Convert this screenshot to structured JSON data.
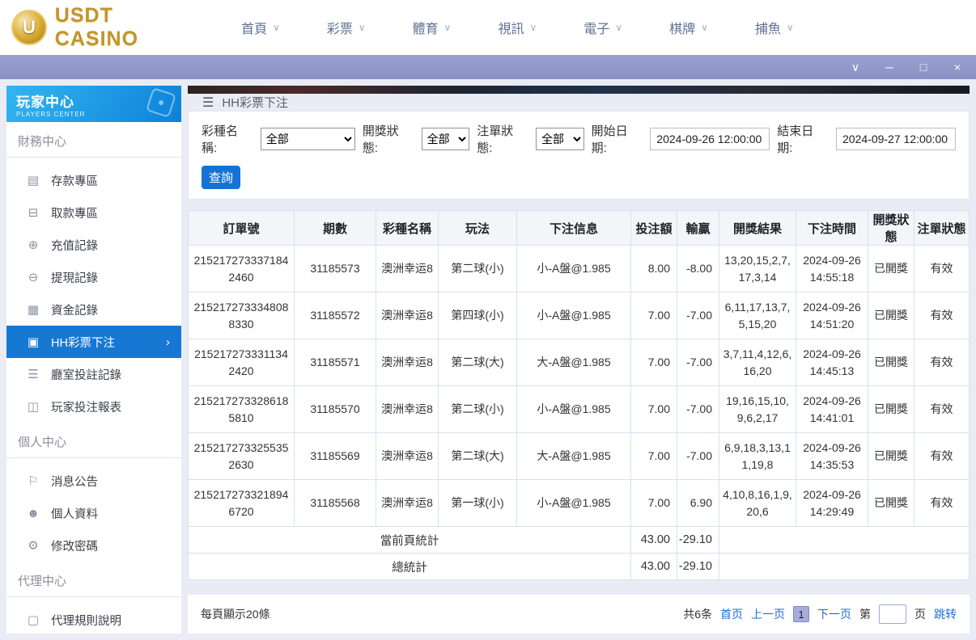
{
  "icons": {
    "hamburger": "☰",
    "nav_chevron": "∨",
    "active_chevron": "›",
    "win_chevron": "∨",
    "win_minimize": "─",
    "win_maximize": "□",
    "win_close": "×"
  },
  "topnav": {
    "logo_initial": "U",
    "logo_text": "USDT CASINO",
    "items": [
      {
        "label": "首頁"
      },
      {
        "label": "彩票"
      },
      {
        "label": "體育"
      },
      {
        "label": "視訊"
      },
      {
        "label": "電子"
      },
      {
        "label": "棋牌"
      },
      {
        "label": "捕魚"
      }
    ]
  },
  "sidebar": {
    "title": "玩家中心",
    "subtitle": "PLAYERS CENTER",
    "sections": [
      {
        "label": "財務中心",
        "items": [
          {
            "glyph": "▤",
            "label": "存款專區"
          },
          {
            "glyph": "⊟",
            "label": "取款專區"
          },
          {
            "glyph": "⊕",
            "label": "充值記錄"
          },
          {
            "glyph": "⊖",
            "label": "提現記錄"
          },
          {
            "glyph": "▦",
            "label": "資金記錄"
          },
          {
            "glyph": "▣",
            "label": "HH彩票下注"
          },
          {
            "glyph": "☰",
            "label": "廳室投註記錄"
          },
          {
            "glyph": "◫",
            "label": "玩家投注報表"
          }
        ]
      },
      {
        "label": "個人中心",
        "items": [
          {
            "glyph": "⚐",
            "label": "消息公告"
          },
          {
            "glyph": "☻",
            "label": "個人資料"
          },
          {
            "glyph": "⚙",
            "label": "修改密碼"
          }
        ]
      },
      {
        "label": "代理中心",
        "items": [
          {
            "glyph": "▢",
            "label": "代理規則說明"
          }
        ]
      }
    ]
  },
  "main": {
    "breadcrumb": "HH彩票下注",
    "filters": {
      "lottery_label": "彩種名稱:",
      "lottery_value": "全部",
      "draw_status_label": "開獎狀態:",
      "draw_status_value": "全部",
      "order_status_label": "注單狀態:",
      "order_status_value": "全部",
      "start_label": "開始日期:",
      "start_value": "2024-09-26 12:00:00",
      "end_label": "結束日期:",
      "end_value": "2024-09-27 12:00:00",
      "search_button": "查詢"
    },
    "table": {
      "headers": [
        "訂單號",
        "期數",
        "彩種名稱",
        "玩法",
        "下注信息",
        "投注額",
        "輸贏",
        "開獎結果",
        "下注時間",
        "開獎狀態",
        "注單狀態"
      ],
      "rows": [
        {
          "order_no": "2152172733371842460",
          "period": "31185573",
          "lottery": "澳洲幸运8",
          "play": "第二球(小)",
          "bet_info": "小-A盤@1.985",
          "amount": "8.00",
          "win": "-8.00",
          "result": "13,20,15,2,7,17,3,14",
          "time": "2024-09-26 14:55:18",
          "draw_status": "已開獎",
          "order_status": "有效"
        },
        {
          "order_no": "2152172733348088330",
          "period": "31185572",
          "lottery": "澳洲幸运8",
          "play": "第四球(小)",
          "bet_info": "小-A盤@1.985",
          "amount": "7.00",
          "win": "-7.00",
          "result": "6,11,17,13,7,5,15,20",
          "time": "2024-09-26 14:51:20",
          "draw_status": "已開獎",
          "order_status": "有效"
        },
        {
          "order_no": "2152172733311342420",
          "period": "31185571",
          "lottery": "澳洲幸运8",
          "play": "第二球(大)",
          "bet_info": "大-A盤@1.985",
          "amount": "7.00",
          "win": "-7.00",
          "result": "3,7,11,4,12,6,16,20",
          "time": "2024-09-26 14:45:13",
          "draw_status": "已開獎",
          "order_status": "有效"
        },
        {
          "order_no": "2152172733286185810",
          "period": "31185570",
          "lottery": "澳洲幸运8",
          "play": "第二球(小)",
          "bet_info": "小-A盤@1.985",
          "amount": "7.00",
          "win": "-7.00",
          "result": "19,16,15,10,9,6,2,17",
          "time": "2024-09-26 14:41:01",
          "draw_status": "已開獎",
          "order_status": "有效"
        },
        {
          "order_no": "2152172733255352630",
          "period": "31185569",
          "lottery": "澳洲幸运8",
          "play": "第二球(大)",
          "bet_info": "大-A盤@1.985",
          "amount": "7.00",
          "win": "-7.00",
          "result": "6,9,18,3,13,11,19,8",
          "time": "2024-09-26 14:35:53",
          "draw_status": "已開獎",
          "order_status": "有效"
        },
        {
          "order_no": "2152172733218946720",
          "period": "31185568",
          "lottery": "澳洲幸运8",
          "play": "第一球(小)",
          "bet_info": "小-A盤@1.985",
          "amount": "7.00",
          "win": "6.90",
          "result": "4,10,8,16,1,9,20,6",
          "time": "2024-09-26 14:29:49",
          "draw_status": "已開獎",
          "order_status": "有效"
        }
      ],
      "page_total_label": "當前頁統計",
      "page_total_amount": "43.00",
      "page_total_win": "-29.10",
      "grand_total_label": "總統計",
      "grand_total_amount": "43.00",
      "grand_total_win": "-29.10"
    },
    "pagination": {
      "per_page": "每頁顯示20條",
      "total": "共6条",
      "first": "首页",
      "prev": "上一页",
      "current": "1",
      "next": "下一页",
      "jump_prefix": "第",
      "jump_suffix": "页",
      "jump_action": "跳转"
    }
  }
}
